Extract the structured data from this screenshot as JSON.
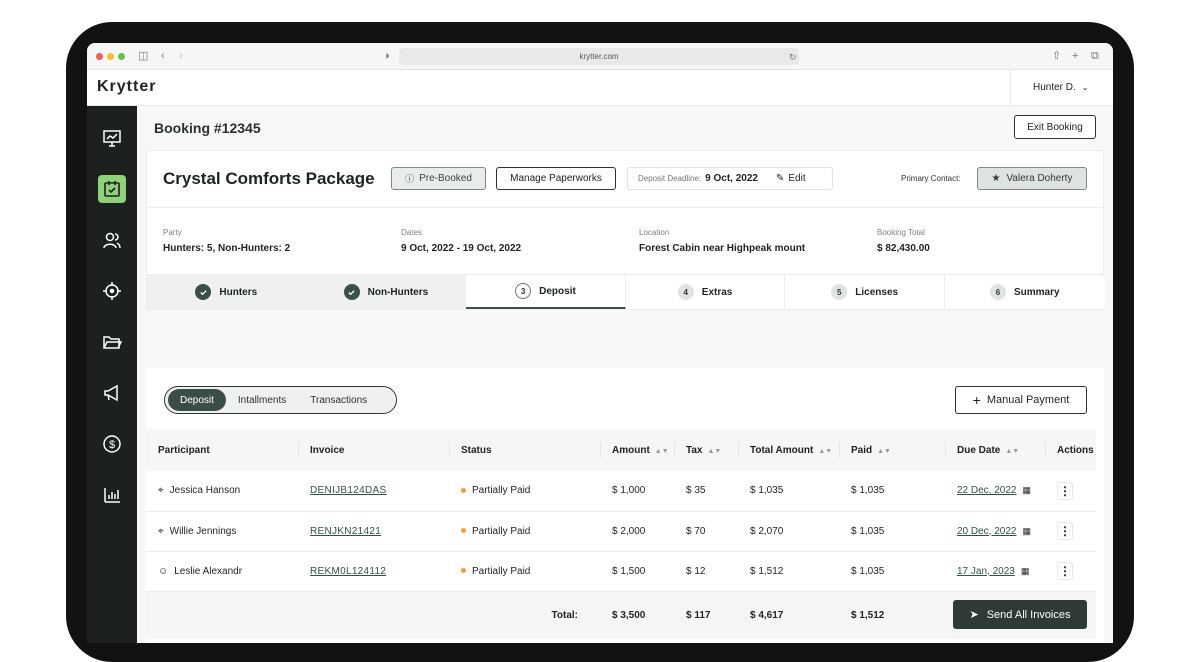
{
  "browser": {
    "url": "krytter.com"
  },
  "app": {
    "logo": "Krytter",
    "user": "Hunter D."
  },
  "sidebar": {
    "items": [
      {
        "name": "dashboard"
      },
      {
        "name": "bookings",
        "active": true
      },
      {
        "name": "customers"
      },
      {
        "name": "hunts"
      },
      {
        "name": "files"
      },
      {
        "name": "marketing"
      },
      {
        "name": "payments"
      },
      {
        "name": "reports"
      }
    ]
  },
  "page": {
    "title": "Booking #12345",
    "exit_label": "Exit Booking"
  },
  "package": {
    "name": "Crystal Comforts Package",
    "status": "Pre-Booked",
    "manage_label": "Manage Paperworks",
    "deadline_label": "Deposit Deadline:",
    "deadline_value": "9 Oct, 2022",
    "edit_label": "Edit",
    "contact_label": "Primary Contact:",
    "contact_name": "Valera Doherty"
  },
  "details": [
    {
      "label": "Party",
      "value": "Hunters: 5, Non-Hunters: 2"
    },
    {
      "label": "Dates",
      "value": "9 Oct, 2022 - 19 Oct, 2022"
    },
    {
      "label": "Location",
      "value": "Forest Cabin near Highpeak mount"
    },
    {
      "label": "Booking Total",
      "value": "$ 82,430.00"
    }
  ],
  "steps": [
    {
      "label": "Hunters",
      "num": "",
      "state": "done"
    },
    {
      "label": "Non-Hunters",
      "num": "",
      "state": "done"
    },
    {
      "label": "Deposit",
      "num": "3",
      "state": "current"
    },
    {
      "label": "Extras",
      "num": "4",
      "state": "todo"
    },
    {
      "label": "Licenses",
      "num": "5",
      "state": "todo"
    },
    {
      "label": "Summary",
      "num": "6",
      "state": "todo"
    }
  ],
  "tabs": {
    "items": [
      "Deposit",
      "Intallments",
      "Transactions"
    ],
    "selected": "Deposit"
  },
  "manual_payment_label": "Manual Payment",
  "table": {
    "columns": [
      "Participant",
      "Invoice",
      "Status",
      "Amount",
      "Tax",
      "Total Amount",
      "Paid",
      "Due Date",
      "Actions"
    ],
    "rows": [
      {
        "participant": "Jessica Hanson",
        "type": "hunter",
        "invoice": "DENIJB124DAS",
        "status": "Partially Paid",
        "amount": "$ 1,000",
        "tax": "$ 35",
        "total": "$ 1,035",
        "paid": "$ 1,035",
        "due": "22 Dec, 2022"
      },
      {
        "participant": "Willie Jennings",
        "type": "hunter",
        "invoice": "RENJKN21421",
        "status": "Partially Paid",
        "amount": "$ 2,000",
        "tax": "$ 70",
        "total": "$ 2,070",
        "paid": "$ 1,035",
        "due": "20 Dec, 2022"
      },
      {
        "participant": "Leslie Alexandr",
        "type": "non-hunter",
        "invoice": "REKM0L124112",
        "status": "Partially Paid",
        "amount": "$ 1,500",
        "tax": "$ 12",
        "total": "$ 1,512",
        "paid": "$ 1,035",
        "due": "17 Jan, 2023"
      }
    ],
    "totals": {
      "label": "Total:",
      "amount": "$ 3,500",
      "tax": "$ 117",
      "total": "$ 4,617",
      "paid": "$ 1,512"
    }
  },
  "send_all_label": "Send All Invoices",
  "colors": {
    "accent": "#8fd07b",
    "dark_green": "#2f3a35",
    "sidebar": "#1c211f",
    "status_dot": "#f39c3b"
  }
}
